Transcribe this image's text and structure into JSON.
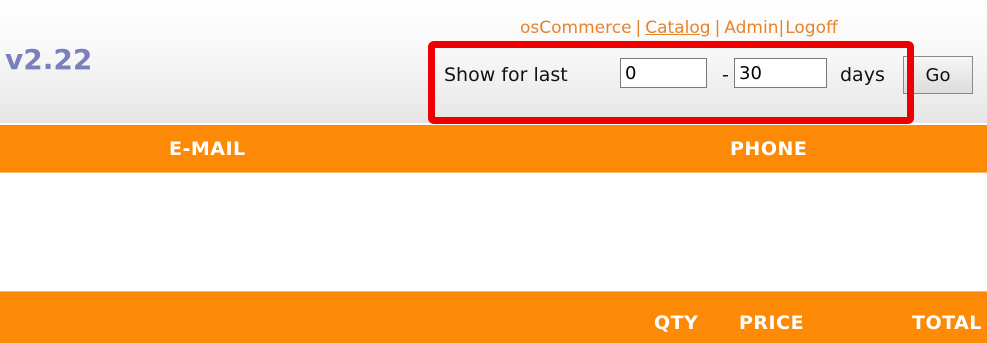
{
  "header": {
    "version": "v2.22",
    "links": [
      {
        "label": "osCommerce"
      },
      {
        "label": "Catalog"
      },
      {
        "label": "Admin"
      },
      {
        "label": "Logoff"
      }
    ],
    "separator": "|"
  },
  "date_range": {
    "label_prefix": "Show for last",
    "from_value": "0",
    "dash": "-",
    "to_value": "30",
    "label_suffix": "days",
    "go_label": "Go"
  },
  "orders_table": {
    "columns": [
      "E-MAIL",
      "PHONE"
    ]
  },
  "products_table": {
    "columns": [
      "QTY",
      "PRICE",
      "TOTAL"
    ]
  },
  "colors": {
    "accent_orange": "#fd8a06",
    "link_orange": "#e6842a",
    "version_purple": "#7a7fbd",
    "highlight_red": "#ee0000"
  }
}
